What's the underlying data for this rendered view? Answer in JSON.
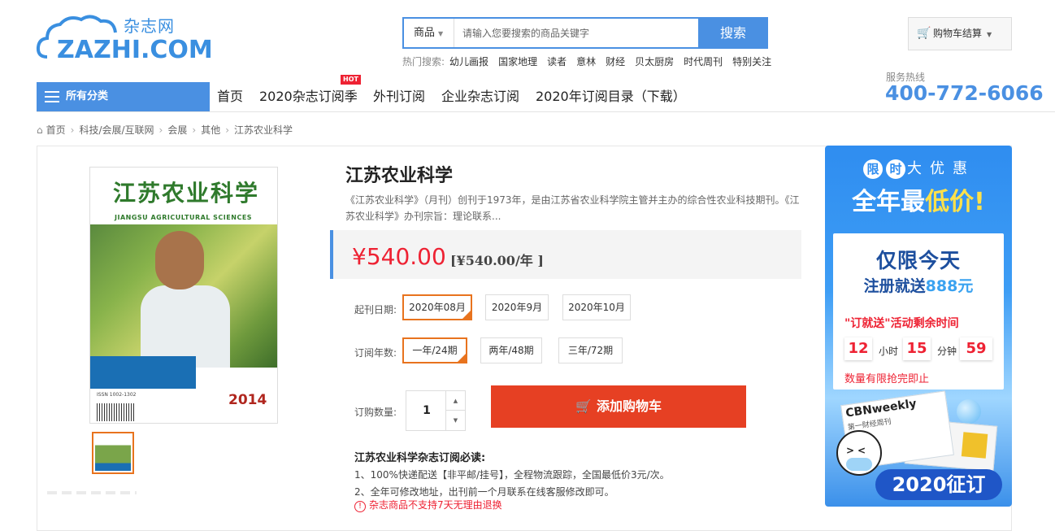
{
  "header": {
    "logo_cn": "杂志网",
    "logo_en": "ZAZHI.COM",
    "search": {
      "category": "商品",
      "placeholder": "请输入您要搜索的商品关键字",
      "button": "搜索"
    },
    "hot_label": "热门搜索:",
    "hot_keywords": [
      "幼儿画报",
      "国家地理",
      "读者",
      "意林",
      "财经",
      "贝太厨房",
      "时代周刊",
      "特别关注"
    ],
    "cart_label": "购物车结算",
    "hotline_label": "服务热线",
    "hotline": "400-772-6066"
  },
  "nav": {
    "all_categories": "所有分类",
    "items": [
      "首页",
      "2020杂志订阅季",
      "外刊订阅",
      "企业杂志订阅",
      "2020年订阅目录（下载）"
    ],
    "hot_badge": "HOT"
  },
  "breadcrumb": [
    "首页",
    "科技/会展/互联网",
    "会展",
    "其他",
    "江苏农业科学"
  ],
  "cover": {
    "title": "江苏农业科学",
    "title_en": "JIANGSU AGRICULTURAL SCIENCES",
    "year": "2014",
    "isbn": "ISSN 1002-1302"
  },
  "product": {
    "name": "江苏农业科学",
    "description": "《江苏农业科学》（月刊）创刊于1973年，是由江苏省农业科学院主管并主办的综合性农业科技期刊。《江苏农业科学》办刊宗旨：理论联系...",
    "price": "¥540.00",
    "price_per": "[¥540.00/年 ]",
    "start_label": "起刊日期:",
    "start_options": [
      "2020年08月",
      "2020年9月",
      "2020年10月"
    ],
    "start_selected": 0,
    "years_label": "订阅年数:",
    "year_options": [
      "一年/24期",
      "两年/48期",
      "三年/72期"
    ],
    "year_selected": 0,
    "qty_label": "订购数量:",
    "qty": "1",
    "add_to_cart": "添加购物车",
    "notes_title": "江苏农业科学杂志订阅必读:",
    "notes": [
      "1、100%快递配送【非平邮/挂号】，全程物流跟踪，全国最低价3元/次。",
      "2、全年可修改地址，出刊前一个月联系在线客服修改即可。"
    ],
    "warning": "杂志商品不支持7天无理由退换"
  },
  "ad": {
    "line1_chars": [
      "限",
      "时",
      "大",
      "优",
      "惠"
    ],
    "line2_a": "全年最",
    "line2_b": "低价!",
    "card_title": "仅限今天",
    "card_sub_a": "注册就送",
    "card_sub_b": "888元",
    "countdown_label": "\"订就送\"活动剩余时间",
    "hours": "12",
    "hours_unit": "小时",
    "minutes": "15",
    "minutes_unit": "分钟",
    "seconds": "59",
    "limited": "数量有限抢完即止",
    "mag_title": "CBNweekly",
    "mag_sub": "第一财经周刊",
    "campaign": "2020征订"
  },
  "colors": {
    "brand_blue": "#4a90e2",
    "price_red": "#e62222",
    "select_orange": "#e8731e",
    "cart_button": "#e64023"
  }
}
